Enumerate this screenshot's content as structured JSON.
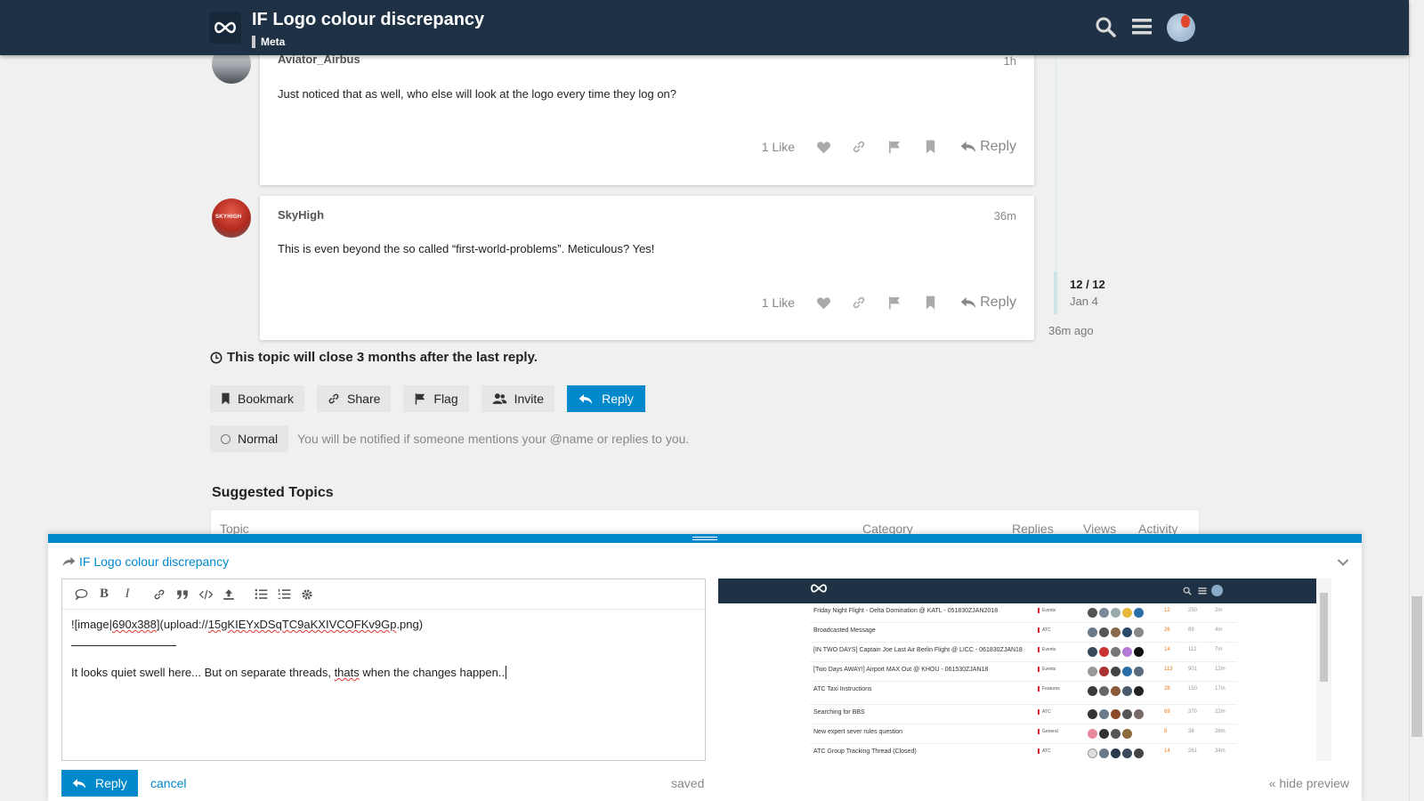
{
  "header": {
    "title": "IF Logo colour discrepancy",
    "category": "Meta",
    "logo_icon": "infinity-logo-icon"
  },
  "posts": [
    {
      "username": "Aviator_Airbus",
      "time": "1h",
      "body": "Just noticed that as well, who else will look at the logo every time they log on?",
      "likes": "1 Like",
      "reply_label": "Reply"
    },
    {
      "username": "SkyHigh",
      "avatar_text": "SKYHIGH",
      "time": "36m",
      "body": "This is even beyond the so called “first-world-problems”. Meticulous? Yes!",
      "likes": "1 Like",
      "reply_label": "Reply"
    }
  ],
  "timeline": {
    "count": "12 / 12",
    "date": "Jan 4",
    "ago": "36m ago"
  },
  "close_notice": "This topic will close 3 months after the last reply.",
  "buttons": {
    "bookmark": "Bookmark",
    "share": "Share",
    "flag": "Flag",
    "invite": "Invite",
    "reply": "Reply"
  },
  "notification": {
    "level": "Normal",
    "description": "You will be notified if someone mentions your @name or replies to you."
  },
  "suggested": {
    "title": "Suggested Topics",
    "columns": [
      "Topic",
      "Category",
      "Replies",
      "Views",
      "Activity"
    ]
  },
  "composer": {
    "title": "IF Logo colour discrepancy",
    "line1_a": "![image|",
    "line1_b": "690x388",
    "line1_c": "](upload://",
    "line1_d": "15gKIEYxDSqTC9aKXIVCOFKv9Gp",
    "line1_e": ".png)",
    "line2_a": "It looks quiet swell here... But on separate threads, ",
    "line2_b": "thats",
    "line2_c": " when the changes happen..",
    "reply_label": "Reply",
    "cancel_label": "cancel",
    "saved_label": "saved",
    "hide_preview_label": "« hide preview"
  },
  "preview": {
    "rows": [
      {
        "title": "Friday Night Flight - Delta Domination @ KATL - 051830ZJAN2018",
        "category": "Events",
        "replies": "12",
        "views": "250",
        "activity": "2m"
      },
      {
        "title": "Broadcasted Message",
        "category": "ATC",
        "replies": "26",
        "views": "89",
        "activity": "4m"
      },
      {
        "title": "[IN TWO DAYS] Captain Joe Last Air Berlin Flight @ LICC - 061830ZJAN18",
        "category": "Events",
        "replies": "14",
        "views": "112",
        "activity": "7m"
      },
      {
        "title": "[Two Days AWAY!] Airport MAX Out @ KHOU - 061530ZJAN18",
        "category": "Events",
        "replies": "113",
        "views": "901",
        "activity": "12m"
      },
      {
        "title": "ATC Taxi Instructions",
        "category": "Features",
        "replies": "28",
        "views": "150",
        "activity": "17m"
      },
      {
        "title": "Searching for BBS",
        "category": "ATC",
        "replies": "69",
        "views": "370",
        "activity": "22m"
      },
      {
        "title": "New expert sever rules question",
        "category": "General",
        "replies": "8",
        "views": "38",
        "activity": "26m"
      },
      {
        "title": "ATC Group Tracking Thread (Closed)",
        "category": "ATC",
        "replies": "14",
        "views": "261",
        "activity": "34m"
      }
    ]
  },
  "colors": {
    "header_bg": "#1f3245",
    "accent": "#0088cc"
  }
}
